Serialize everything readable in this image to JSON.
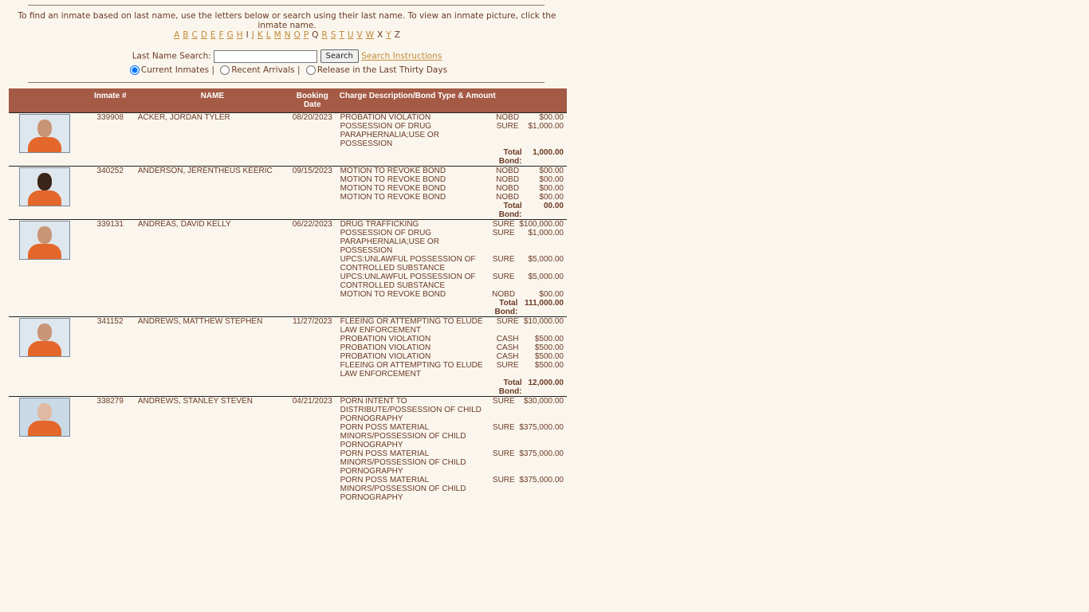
{
  "instructions": "To find an inmate based on last name, use the letters below or search using their last name.  To view an inmate picture, click the inmate name.",
  "letters": [
    {
      "l": "A",
      "link": true
    },
    {
      "l": "B",
      "link": true
    },
    {
      "l": "C",
      "link": true
    },
    {
      "l": "D",
      "link": true
    },
    {
      "l": "E",
      "link": true
    },
    {
      "l": "F",
      "link": true
    },
    {
      "l": "G",
      "link": true
    },
    {
      "l": "H",
      "link": true
    },
    {
      "l": "I",
      "link": false
    },
    {
      "l": "J",
      "link": true
    },
    {
      "l": "K",
      "link": true
    },
    {
      "l": "L",
      "link": true
    },
    {
      "l": "M",
      "link": true
    },
    {
      "l": "N",
      "link": true
    },
    {
      "l": "O",
      "link": true
    },
    {
      "l": "P",
      "link": true
    },
    {
      "l": "Q",
      "link": false
    },
    {
      "l": "R",
      "link": true
    },
    {
      "l": "S",
      "link": true
    },
    {
      "l": "T",
      "link": true
    },
    {
      "l": "U",
      "link": true
    },
    {
      "l": "V",
      "link": true
    },
    {
      "l": "W",
      "link": true
    },
    {
      "l": "X",
      "link": false
    },
    {
      "l": "Y",
      "link": true
    },
    {
      "l": "Z",
      "link": false
    }
  ],
  "search": {
    "label": "Last Name Search:",
    "value": "",
    "button": "Search",
    "instructions_link": "Search Instructions"
  },
  "filters": [
    {
      "label": "Current Inmates",
      "checked": true,
      "sep": "|"
    },
    {
      "label": "Recent Arrivals",
      "checked": false,
      "sep": "|"
    },
    {
      "label": "Release in the Last Thirty Days",
      "checked": false,
      "sep": ""
    }
  ],
  "table": {
    "headers": {
      "inmate_no": "Inmate #",
      "name": "NAME",
      "booking": "Booking Date",
      "charges": "Charge Description/Bond Type & Amount"
    },
    "total_label": "Total Bond:"
  },
  "inmates": [
    {
      "number": "339908",
      "name": "ACKER, JORDAN TYLER",
      "booking": "08/20/2023",
      "photo": "tan",
      "charges": [
        {
          "desc": "PROBATION VIOLATION",
          "type": "NOBD",
          "amount": "$00.00"
        },
        {
          "desc": "POSSESSION OF DRUG PARAPHERNALIA;USE OR POSSESSION",
          "type": "SURE",
          "amount": "$1,000.00"
        }
      ],
      "total": "1,000.00"
    },
    {
      "number": "340252",
      "name": "ANDERSON, JERENTHEUS KEERIC",
      "booking": "09/15/2023",
      "photo": "dark",
      "charges": [
        {
          "desc": "MOTION TO REVOKE BOND",
          "type": "NOBD",
          "amount": "$00.00"
        },
        {
          "desc": "MOTION TO REVOKE BOND",
          "type": "NOBD",
          "amount": "$00.00"
        },
        {
          "desc": "MOTION TO REVOKE BOND",
          "type": "NOBD",
          "amount": "$00.00"
        },
        {
          "desc": "MOTION TO REVOKE BOND",
          "type": "NOBD",
          "amount": "$00.00"
        }
      ],
      "total": "00.00"
    },
    {
      "number": "339131",
      "name": "ANDREAS, DAVID KELLY",
      "booking": "06/22/2023",
      "photo": "tan",
      "charges": [
        {
          "desc": "DRUG TRAFFICKING",
          "type": "SURE",
          "amount": "$100,000.00"
        },
        {
          "desc": "POSSESSION OF DRUG PARAPHERNALIA;USE OR POSSESSION",
          "type": "SURE",
          "amount": "$1,000.00"
        },
        {
          "desc": "UPCS:UNLAWFUL POSSESSION OF CONTROLLED SUBSTANCE",
          "type": "SURE",
          "amount": "$5,000.00"
        },
        {
          "desc": "UPCS:UNLAWFUL POSSESSION OF CONTROLLED SUBSTANCE",
          "type": "SURE",
          "amount": "$5,000.00"
        },
        {
          "desc": "MOTION TO REVOKE BOND",
          "type": "NOBD",
          "amount": "$00.00"
        }
      ],
      "total": "111,000.00"
    },
    {
      "number": "341152",
      "name": "ANDREWS, MATTHEW STEPHEN",
      "booking": "11/27/2023",
      "photo": "tan",
      "charges": [
        {
          "desc": "FLEEING OR ATTEMPTING TO ELUDE LAW ENFORCEMENT",
          "type": "SURE",
          "amount": "$10,000.00"
        },
        {
          "desc": "PROBATION VIOLATION",
          "type": "CASH",
          "amount": "$500.00"
        },
        {
          "desc": "PROBATION VIOLATION",
          "type": "CASH",
          "amount": "$500.00"
        },
        {
          "desc": "PROBATION VIOLATION",
          "type": "CASH",
          "amount": "$500.00"
        },
        {
          "desc": "FLEEING OR ATTEMPTING TO ELUDE LAW ENFORCEMENT",
          "type": "SURE",
          "amount": "$500.00"
        }
      ],
      "total": "12,000.00"
    },
    {
      "number": "338279",
      "name": "ANDREWS, STANLEY STEVEN",
      "booking": "04/21/2023",
      "photo": "pale",
      "charges": [
        {
          "desc": "PORN INTENT TO DISTRIBUTE/POSSESSION OF CHILD PORNOGRAPHY",
          "type": "SURE",
          "amount": "$30,000.00"
        },
        {
          "desc": "PORN POSS MATERIAL MINORS/POSSESSION OF CHILD PORNOGRAPHY",
          "type": "SURE",
          "amount": "$375,000.00"
        },
        {
          "desc": "PORN POSS MATERIAL MINORS/POSSESSION OF CHILD PORNOGRAPHY",
          "type": "SURE",
          "amount": "$375,000.00"
        },
        {
          "desc": "PORN POSS MATERIAL MINORS/POSSESSION OF CHILD PORNOGRAPHY",
          "type": "SURE",
          "amount": "$375,000.00"
        }
      ],
      "total": null
    }
  ],
  "colors": {
    "header_bg": "#a45a45",
    "text": "#6b3a24",
    "link": "#c08a35",
    "page_bg": "#faf6ee"
  }
}
